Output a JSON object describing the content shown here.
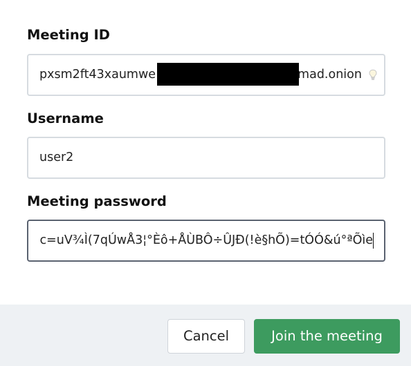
{
  "form": {
    "meeting_id": {
      "label": "Meeting ID",
      "value_prefix": "pxsm2ft43xaumwe",
      "value_suffix": "mad.onion"
    },
    "username": {
      "label": "Username",
      "value": "user2"
    },
    "password": {
      "label": "Meeting password",
      "value": "c=uV¾Ì(7qÚwÅ3¦°Èô+ÅÙBÔ÷ÛJÐ(!è§hÕ)=tÓÓ&ú°ªÕìe"
    }
  },
  "footer": {
    "cancel_label": "Cancel",
    "join_label": "Join the meeting"
  },
  "colors": {
    "join_button": "#3d9b5f",
    "footer_background": "#eef1f4",
    "field_border": "#d6dbe0",
    "focused_border": "#5a6270"
  },
  "icons": {
    "meeting_id_hint": "lightbulb-icon"
  }
}
